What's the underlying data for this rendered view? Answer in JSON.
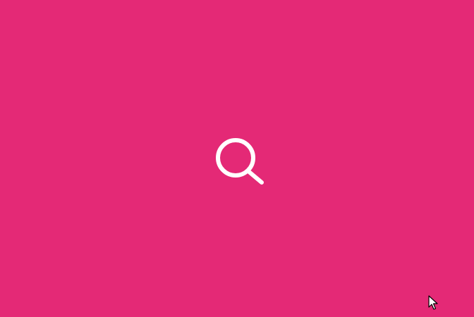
{
  "screen": {
    "background_color": "#e42976"
  },
  "search": {
    "icon": "search-icon",
    "icon_color": "#ffffff"
  },
  "cursor": {
    "icon": "arrow-pointer-icon",
    "fill_color": "#ffffff",
    "outline_color": "#000000"
  }
}
